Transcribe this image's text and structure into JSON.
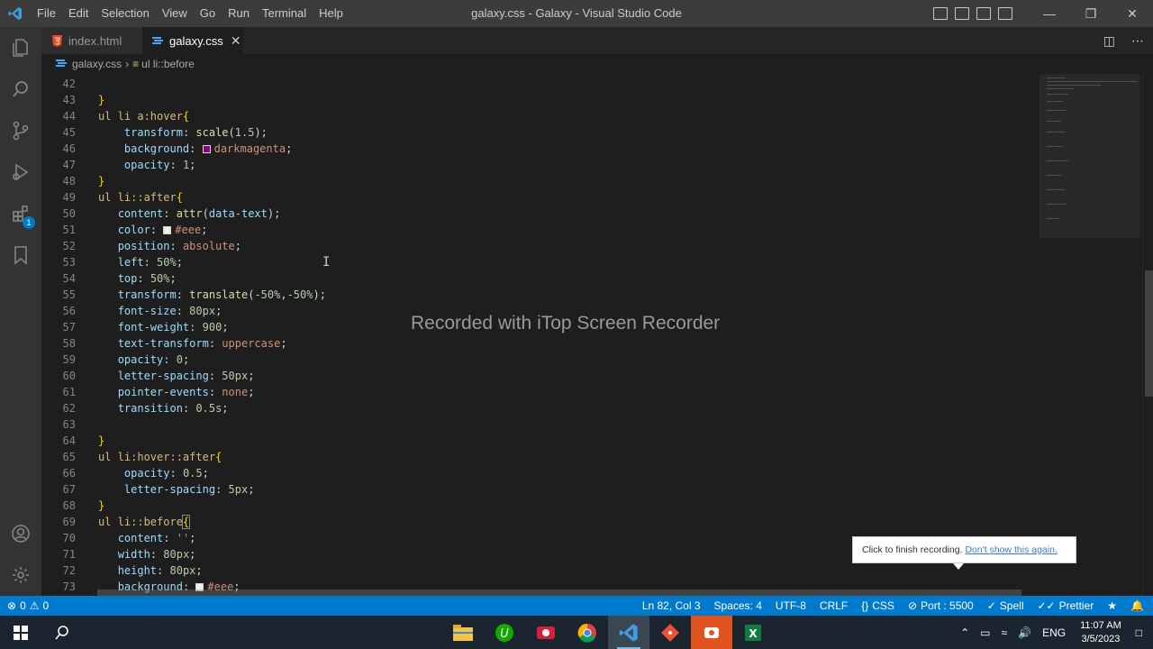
{
  "window": {
    "title": "galaxy.css - Galaxy - Visual Studio Code",
    "menu": [
      "File",
      "Edit",
      "Selection",
      "View",
      "Go",
      "Run",
      "Terminal",
      "Help"
    ]
  },
  "tabs": [
    {
      "label": "index.html",
      "icon": "html5-icon",
      "active": false
    },
    {
      "label": "galaxy.css",
      "icon": "css3-icon",
      "active": true
    }
  ],
  "breadcrumb": {
    "file": "galaxy.css",
    "symbol": "ul li::before"
  },
  "activitybar": {
    "extensions_badge": "1"
  },
  "editor": {
    "line_numbers": [
      "42",
      "43",
      "44",
      "45",
      "46",
      "47",
      "48",
      "49",
      "50",
      "51",
      "52",
      "53",
      "54",
      "55",
      "56",
      "57",
      "58",
      "59",
      "60",
      "61",
      "62",
      "63",
      "64",
      "65",
      "66",
      "67",
      "68",
      "69",
      "70",
      "71",
      "72",
      "73"
    ],
    "overlay_text": "Recorded with iTop Screen Recorder"
  },
  "toast": {
    "text": "Click to finish recording.",
    "link": "Don't show this again."
  },
  "statusbar": {
    "errors": "0",
    "warnings": "0",
    "position": "Ln 82, Col 3",
    "spaces": "Spaces: 4",
    "encoding": "UTF-8",
    "eol": "CRLF",
    "language": "CSS",
    "port": "Port : 5500",
    "spell": "Spell",
    "prettier": "Prettier"
  },
  "taskbar": {
    "language": "ENG",
    "time": "11:07 AM",
    "date": "3/5/2023"
  },
  "colors": {
    "accent": "#007acc",
    "editor_bg": "#1e1e1e",
    "darkmagenta": "#8b008b",
    "eee": "#eeeeee"
  }
}
